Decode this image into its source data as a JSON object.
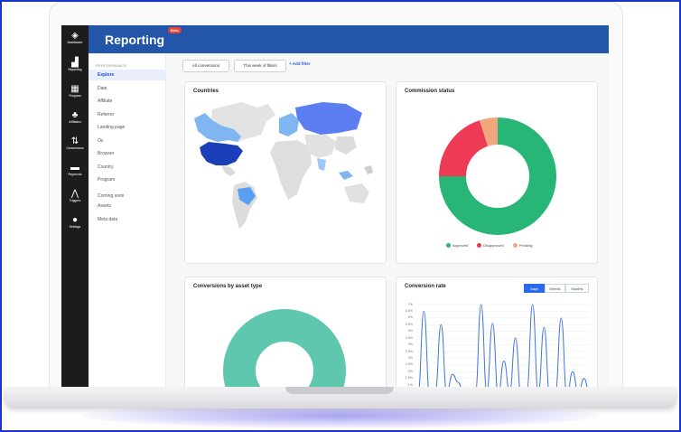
{
  "app": {
    "title": "Reporting",
    "badge": "Beta"
  },
  "rail": [
    {
      "label": "Dashboard",
      "icon": "dashboard-icon",
      "glyph": "◈"
    },
    {
      "label": "Reporting",
      "icon": "chart-icon",
      "glyph": "▟"
    },
    {
      "label": "Program",
      "icon": "program-icon",
      "glyph": "▦"
    },
    {
      "label": "Affiliates",
      "icon": "users-icon",
      "glyph": "♣"
    },
    {
      "label": "Conversions",
      "icon": "sort-arrows-icon",
      "glyph": "⇅"
    },
    {
      "label": "Payments",
      "icon": "wallet-icon",
      "glyph": "▬"
    },
    {
      "label": "Triggers",
      "icon": "triggers-icon",
      "glyph": "⋀"
    },
    {
      "label": "Settings",
      "icon": "gear-icon",
      "glyph": "●"
    }
  ],
  "subnav": {
    "section": "PERFORMANCE",
    "items": [
      "Explore",
      "Date",
      "Affiliate",
      "Referrer",
      "Landing page",
      "Os",
      "Browser",
      "Country",
      "Program",
      "Coming soon",
      "Assets",
      "Meta data"
    ]
  },
  "filters": {
    "all": "All conversions",
    "week": "This week of filters",
    "add": "+ Add filter"
  },
  "cards": {
    "countries": "Countries",
    "commission": "Commission status",
    "asset": "Conversions by asset type",
    "rate": "Conversion rate"
  },
  "commission_legend": [
    {
      "label": "Approved",
      "color": "#27b675"
    },
    {
      "label": "Disapproved",
      "color": "#ef3a55"
    },
    {
      "label": "Pending",
      "color": "#f1a67b"
    }
  ],
  "rate_toggle": [
    "Days",
    "Weeks",
    "Months"
  ],
  "colors": {
    "brand": "#2356a8",
    "rail": "#1c1c1c",
    "accent": "#2a6ae8",
    "asset": "#5ec7ad"
  },
  "chart_data": [
    {
      "type": "pie",
      "title": "Commission status",
      "categories": [
        "Approved",
        "Disapproved",
        "Pending"
      ],
      "values": [
        75,
        20,
        5
      ]
    },
    {
      "type": "line",
      "title": "Conversion rate",
      "yticks": [
        "7%",
        "6.5%",
        "6%",
        "5.5%",
        "5%",
        "4.5%",
        "4%",
        "3.5%",
        "3%",
        "2.5%",
        "2%",
        "1.5%",
        "1%",
        "0.5%",
        "0%"
      ],
      "ylim": [
        0,
        7
      ],
      "series": [
        {
          "values": [
            0.5,
            6.5,
            0.3,
            0.6,
            5.5,
            0.4,
            1.8,
            1.2,
            0.3,
            0.2,
            0.4,
            7,
            0.5,
            5.6,
            0.3,
            2.8,
            0.5,
            4.5,
            0.2,
            0.6,
            7,
            0.4,
            5.3,
            0.3,
            0.5,
            6,
            0.2,
            2,
            0.4,
            1.5,
            0.2
          ]
        }
      ]
    }
  ]
}
